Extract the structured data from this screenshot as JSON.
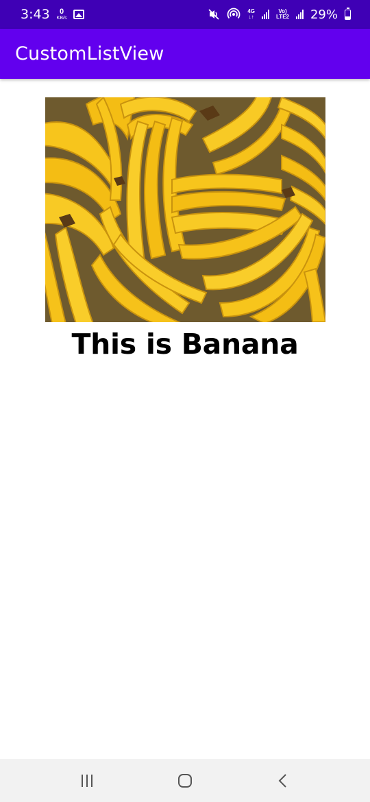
{
  "status_bar": {
    "time": "3:43",
    "net_speed_value": "0",
    "net_speed_unit": "KB/s",
    "network_label": "4G",
    "volte_label": "Vo)",
    "lte_label": "LTE2",
    "battery": "29%"
  },
  "app_bar": {
    "title": "CustomListView"
  },
  "list": {
    "items": [
      {
        "image": "banana-image",
        "caption": "This is Banana"
      }
    ]
  },
  "nav_bar": {
    "recents_icon": "recents-icon",
    "home_icon": "home-icon",
    "back_icon": "back-icon"
  },
  "colors": {
    "status_bar": "#3f00b5",
    "app_bar": "#6200ee",
    "nav_bar": "#f2f2f2",
    "banana": "#f5c518"
  }
}
